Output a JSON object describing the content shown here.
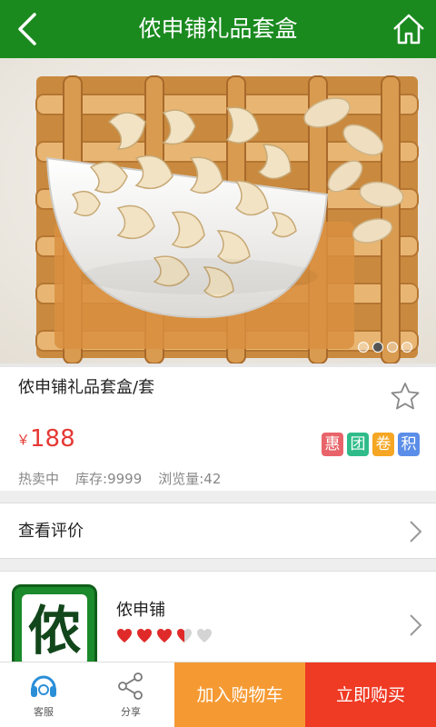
{
  "header": {
    "title": "侬申铺礼品套盒",
    "back_icon": "back-chevron-icon",
    "home_icon": "home-icon",
    "color": "#1a8a1f"
  },
  "banner": {
    "image": "cashews-in-white-bowl-on-bamboo-mat",
    "slides": 4,
    "active_slide": 2
  },
  "product": {
    "name": "侬申铺礼品套盒/套",
    "currency": "￥",
    "price": "188",
    "badges": [
      {
        "label": "惠",
        "color": "#e8646a"
      },
      {
        "label": "团",
        "color": "#2fbc8a"
      },
      {
        "label": "卷",
        "color": "#f5a623"
      },
      {
        "label": "积",
        "color": "#5b8ee8"
      }
    ],
    "status": "热卖中",
    "stock": "库存:9999",
    "views": "浏览量:42",
    "favorite_icon": "star-outline-icon"
  },
  "reviews": {
    "label": "查看评价"
  },
  "shop": {
    "logo_text": "侬",
    "name": "侬申铺",
    "rating": 3.5,
    "rating_max": 5
  },
  "bottombar": {
    "service_label": "客服",
    "share_label": "分享",
    "cart_label": "加入购物车",
    "buy_label": "立即购买"
  }
}
